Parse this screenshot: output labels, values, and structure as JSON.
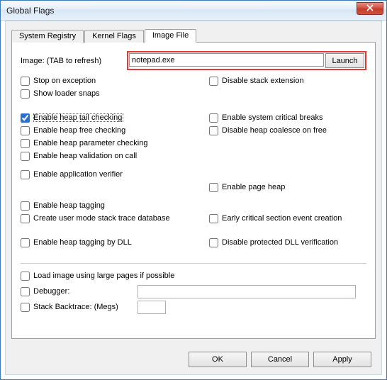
{
  "window": {
    "title": "Global Flags"
  },
  "tabs": {
    "system_registry": "System Registry",
    "kernel_flags": "Kernel Flags",
    "image_file": "Image File"
  },
  "image": {
    "label": "Image: (TAB to refresh)",
    "value": "notepad.exe",
    "launch": "Launch"
  },
  "checks": {
    "stop_on_exception": "Stop on exception",
    "show_loader_snaps": "Show loader snaps",
    "disable_stack_extension": "Disable stack extension",
    "enable_heap_tail_checking": "Enable heap tail checking",
    "enable_heap_free_checking": "Enable heap free checking",
    "enable_heap_parameter_checking": "Enable heap parameter checking",
    "enable_heap_validation_on_call": "Enable heap validation on call",
    "enable_system_critical_breaks": "Enable system critical breaks",
    "disable_heap_coalesce_on_free": "Disable heap coalesce on free",
    "enable_application_verifier": "Enable application verifier",
    "enable_page_heap": "Enable page heap",
    "enable_heap_tagging": "Enable heap tagging",
    "create_user_mode_stack_trace_database": "Create user mode stack trace database",
    "early_critical_section_event_creation": "Early critical section event creation",
    "enable_heap_tagging_by_dll": "Enable heap tagging by DLL",
    "disable_protected_dll_verification": "Disable protected DLL verification",
    "load_image_using_large_pages": "Load image using large pages if possible",
    "debugger": "Debugger:",
    "stack_backtrace": "Stack Backtrace: (Megs)"
  },
  "buttons": {
    "ok": "OK",
    "cancel": "Cancel",
    "apply": "Apply"
  }
}
